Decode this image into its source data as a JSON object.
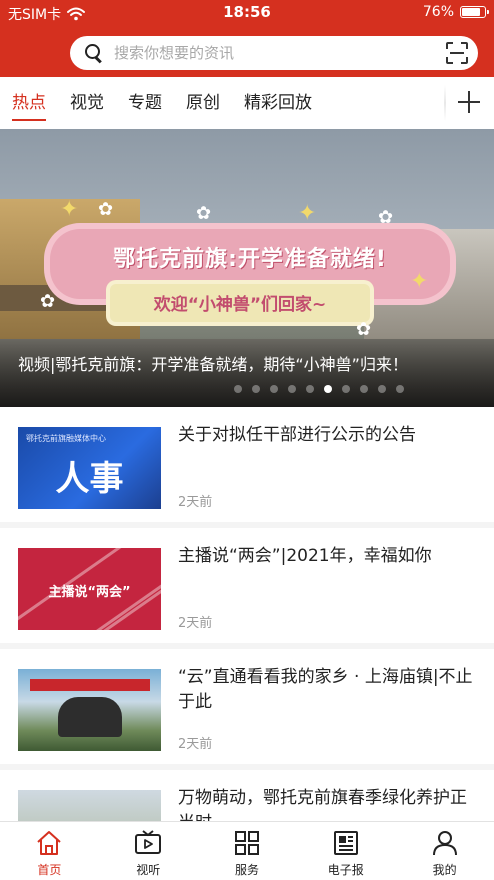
{
  "status_bar": {
    "carrier": "无SIM卡",
    "time": "18:56",
    "battery": "76%",
    "battery_level": 0.76
  },
  "search": {
    "placeholder": "搜索你想要的资讯",
    "icon": "search-icon",
    "scan_icon": "scan-icon"
  },
  "colors": {
    "brand": "#d5301f",
    "text": "#222222",
    "muted": "#9a9a9a"
  },
  "tabs": [
    {
      "label": "热点",
      "active": true
    },
    {
      "label": "视觉",
      "active": false
    },
    {
      "label": "专题",
      "active": false
    },
    {
      "label": "原创",
      "active": false
    },
    {
      "label": "精彩回放",
      "active": false
    }
  ],
  "tabs_add_icon": "plus-icon",
  "banner": {
    "headline": "鄂托克前旗:开学准备就绪!",
    "ribbon": "欢迎“小神兽”们回家~",
    "caption": "视频|鄂托克前旗：开学准备就绪，期待“小神兽”归来！",
    "slide_count": 10,
    "active_slide": 6
  },
  "news": [
    {
      "title": "关于对拟任干部进行公示的公告",
      "time": "2天前",
      "thumb_text": "人事",
      "thumb_small": "鄂托克前旗融媒体中心"
    },
    {
      "title": "主播说“两会”|2021年，幸福如你",
      "time": "2天前",
      "thumb_text": "主播说“两会”"
    },
    {
      "title": "“云”直通看看我的家乡 · 上海庙镇|不止于此",
      "time": "2天前"
    },
    {
      "title": "万物萌动，鄂托克前旗春季绿化养护正当时",
      "time": ""
    }
  ],
  "bottom_tabs": [
    {
      "label": "首页",
      "icon": "home-icon",
      "active": true
    },
    {
      "label": "视听",
      "icon": "video-icon",
      "active": false
    },
    {
      "label": "服务",
      "icon": "grid-icon",
      "active": false
    },
    {
      "label": "电子报",
      "icon": "newspaper-icon",
      "active": false
    },
    {
      "label": "我的",
      "icon": "person-icon",
      "active": false
    }
  ]
}
